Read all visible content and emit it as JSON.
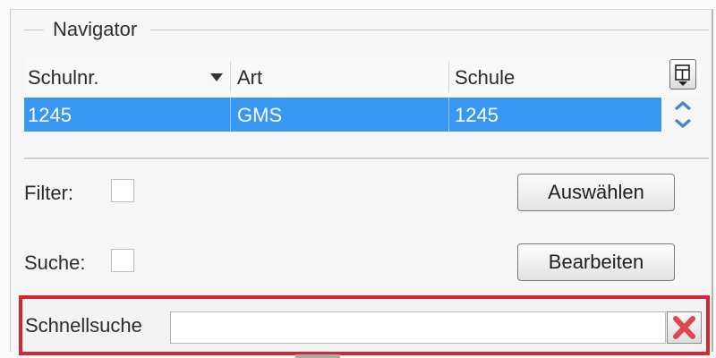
{
  "navigator": {
    "title": "Navigator",
    "columns": [
      "Schulnr.",
      "Art",
      "Schule"
    ],
    "selected_row": [
      "1245",
      "GMS",
      "1245"
    ]
  },
  "filter": {
    "label": "Filter:",
    "checked": false
  },
  "search": {
    "label": "Suche:",
    "checked": false
  },
  "buttons": {
    "select": "Auswählen",
    "edit": "Bearbeiten"
  },
  "quick_search": {
    "label": "Schnellsuche",
    "value": ""
  },
  "icons": {
    "sort": "sort-down-icon",
    "column_chooser": "column-chooser-icon",
    "scroll_up": "chevron-up-icon",
    "scroll_down": "chevron-down-icon",
    "clear": "red-x-close-icon"
  },
  "colors": {
    "selection": "#3797f3",
    "highlight_frame": "#d9262c",
    "clear_icon": "#e0474c"
  }
}
